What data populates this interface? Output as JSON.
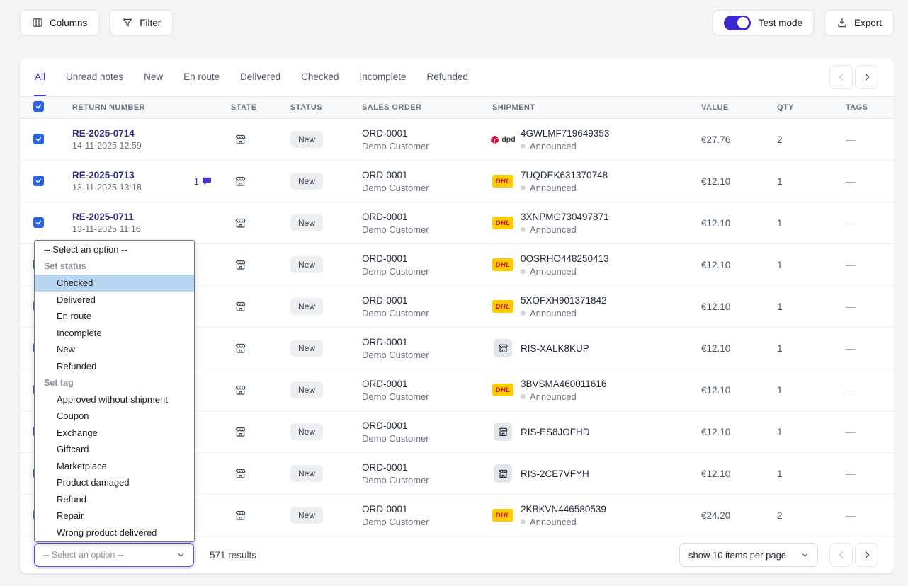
{
  "toolbar": {
    "columns_label": "Columns",
    "filter_label": "Filter",
    "test_mode_label": "Test mode",
    "export_label": "Export"
  },
  "tabs": [
    "All",
    "Unread notes",
    "New",
    "En route",
    "Delivered",
    "Checked",
    "Incomplete",
    "Refunded"
  ],
  "active_tab": "All",
  "table": {
    "headers": {
      "return_number": "RETURN NUMBER",
      "state": "STATE",
      "status": "STATUS",
      "sales_order": "SALES ORDER",
      "shipment": "SHIPMENT",
      "value": "VALUE",
      "qty": "QTY",
      "tags": "TAGS"
    },
    "rows": [
      {
        "checked": true,
        "return_number": "RE-2025-0714",
        "date": "14-11-2025 12:59",
        "comments": "",
        "status": "New",
        "sales_order": "ORD-0001",
        "customer": "Demo Customer",
        "carrier": "dpd",
        "tracking": "4GWLMF719649353",
        "shipment_status": "Announced",
        "value": "€27.76",
        "qty": "2",
        "tags": "—"
      },
      {
        "checked": true,
        "return_number": "RE-2025-0713",
        "date": "13-11-2025 13:18",
        "comments": "1",
        "status": "New",
        "sales_order": "ORD-0001",
        "customer": "Demo Customer",
        "carrier": "dhl",
        "tracking": "7UQDEK631370748",
        "shipment_status": "Announced",
        "value": "€12.10",
        "qty": "1",
        "tags": "—"
      },
      {
        "checked": true,
        "return_number": "RE-2025-0711",
        "date": "13-11-2025 11:16",
        "comments": "",
        "status": "New",
        "sales_order": "ORD-0001",
        "customer": "Demo Customer",
        "carrier": "dhl",
        "tracking": "3XNPMG730497871",
        "shipment_status": "Announced",
        "value": "€12.10",
        "qty": "1",
        "tags": "—"
      },
      {
        "checked": true,
        "return_number": "",
        "date": "",
        "comments": "",
        "status": "New",
        "sales_order": "ORD-0001",
        "customer": "Demo Customer",
        "carrier": "dhl",
        "tracking": "0OSRHO448250413",
        "shipment_status": "Announced",
        "value": "€12.10",
        "qty": "1",
        "tags": "—"
      },
      {
        "checked": true,
        "return_number": "",
        "date": "",
        "comments": "",
        "status": "New",
        "sales_order": "ORD-0001",
        "customer": "Demo Customer",
        "carrier": "dhl",
        "tracking": "5XOFXH901371842",
        "shipment_status": "Announced",
        "value": "€12.10",
        "qty": "1",
        "tags": "—"
      },
      {
        "checked": true,
        "return_number": "",
        "date": "",
        "comments": "",
        "status": "New",
        "sales_order": "ORD-0001",
        "customer": "Demo Customer",
        "carrier": "store",
        "tracking": "RIS-XALK8KUP",
        "shipment_status": "",
        "value": "€12.10",
        "qty": "1",
        "tags": "—"
      },
      {
        "checked": true,
        "return_number": "",
        "date": "",
        "comments": "",
        "status": "New",
        "sales_order": "ORD-0001",
        "customer": "Demo Customer",
        "carrier": "dhl",
        "tracking": "3BVSMA460011616",
        "shipment_status": "Announced",
        "value": "€12.10",
        "qty": "1",
        "tags": "—"
      },
      {
        "checked": true,
        "return_number": "",
        "date": "",
        "comments": "",
        "status": "New",
        "sales_order": "ORD-0001",
        "customer": "Demo Customer",
        "carrier": "store",
        "tracking": "RIS-ES8JOFHD",
        "shipment_status": "",
        "value": "€12.10",
        "qty": "1",
        "tags": "—"
      },
      {
        "checked": true,
        "return_number": "",
        "date": "",
        "comments": "",
        "status": "New",
        "sales_order": "ORD-0001",
        "customer": "Demo Customer",
        "carrier": "store",
        "tracking": "RIS-2CE7VFYH",
        "shipment_status": "",
        "value": "€12.10",
        "qty": "1",
        "tags": "—"
      },
      {
        "checked": true,
        "return_number": "",
        "date": "",
        "comments": "",
        "status": "New",
        "sales_order": "ORD-0001",
        "customer": "Demo Customer",
        "carrier": "dhl",
        "tracking": "2KBKVN446580539",
        "shipment_status": "Announced",
        "value": "€24.20",
        "qty": "2",
        "tags": "—"
      }
    ]
  },
  "carriers": {
    "dpd": {
      "label": "dpd"
    },
    "dhl": {
      "label": "DHL"
    }
  },
  "bulk_dropdown": {
    "placeholder": "-- Select an option --",
    "highlighted_option": "Checked",
    "groups": [
      {
        "label": "Set status",
        "options": [
          "Checked",
          "Delivered",
          "En route",
          "Incomplete",
          "New",
          "Refunded"
        ]
      },
      {
        "label": "Set tag",
        "options": [
          "Approved without shipment",
          "Coupon",
          "Exchange",
          "Giftcard",
          "Marketplace",
          "Product damaged",
          "Refund",
          "Repair",
          "Wrong product delivered"
        ]
      }
    ]
  },
  "footer": {
    "bulk_select_value": "-- Select an option --",
    "results_label": "571 results",
    "page_size_label": "show 10 items per page"
  },
  "colors": {
    "accent": "#4338ca",
    "toggle_on": "#3a28cf",
    "checkbox": "#2563eb",
    "dhl_yellow": "#ffcc00",
    "dhl_red": "#d40511",
    "dpd_red": "#dc0032",
    "highlight_blue": "#b7d4f1"
  }
}
